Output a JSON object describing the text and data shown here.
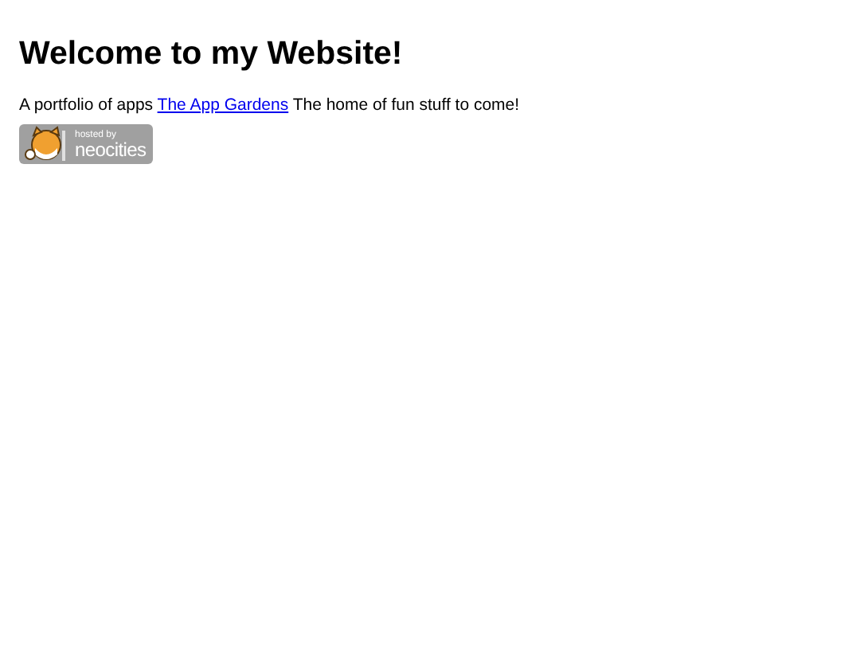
{
  "heading": "Welcome to my Website!",
  "intro": {
    "before": "A portfolio of apps",
    "link": "The App Gardens",
    "after": "The home of fun stuff to come!"
  },
  "badge": {
    "line_1": "hosted by",
    "line_2": "neocities"
  }
}
